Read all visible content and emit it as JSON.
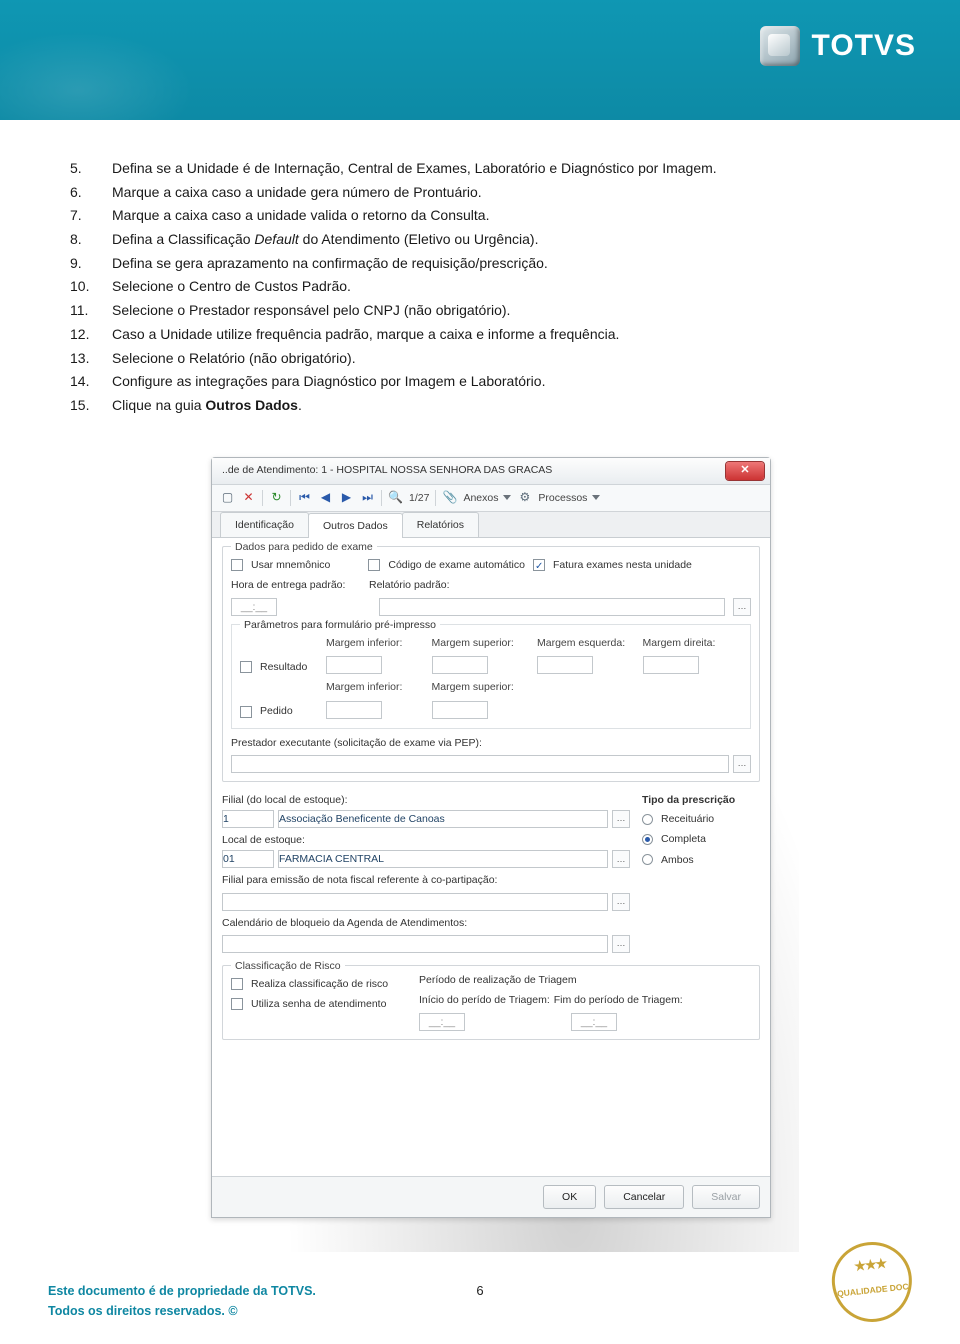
{
  "logo_text": "TOTVS",
  "list": [
    {
      "n": "5.",
      "txt": "Defina se a Unidade é de Internação, Central de Exames, Laboratório e Diagnóstico por Imagem."
    },
    {
      "n": "6.",
      "txt": "Marque a caixa caso a unidade gera número de Prontuário."
    },
    {
      "n": "7.",
      "txt": "Marque a caixa caso a unidade valida o retorno da Consulta."
    },
    {
      "n": "8.",
      "pre": "Defina a Classificação ",
      "em": "Default",
      "post": " do Atendimento (Eletivo ou Urgência)."
    },
    {
      "n": "9.",
      "txt": "Defina se gera aprazamento na confirmação de requisição/prescrição."
    },
    {
      "n": "10.",
      "txt": "Selecione o Centro de Custos Padrão."
    },
    {
      "n": "11.",
      "txt": "Selecione o Prestador responsável pelo CNPJ (não obrigatório)."
    },
    {
      "n": "12.",
      "txt": "Caso a Unidade utilize frequência padrão, marque a caixa e informe a frequência."
    },
    {
      "n": "13.",
      "txt": "Selecione o Relatório (não obrigatório)."
    },
    {
      "n": "14.",
      "txt": "Configure as integrações para Diagnóstico por Imagem e Laboratório."
    },
    {
      "n": "15.",
      "pre": "Clique na guia ",
      "strong": "Outros Dados",
      "post": "."
    }
  ],
  "window": {
    "title": "..de de Atendimento: 1 - HOSPITAL NOSSA SENHORA DAS GRACAS",
    "pager": "1/27",
    "menu_anexos": "Anexos",
    "menu_processos": "Processos",
    "tabs": [
      "Identificação",
      "Outros Dados",
      "Relatórios"
    ],
    "g_exame_title": "Dados para pedido de exame",
    "cb_mnemonico": "Usar mnemônico",
    "cb_codigo_auto": "Código de exame automático",
    "cb_fatura_unidade": "Fatura exames nesta unidade",
    "lbl_hora_entrega": "Hora de entrega padrão:",
    "val_hora_entrega": "__:__",
    "lbl_relatorio_padrao": "Relatório padrão:",
    "sg_param": "Parâmetros para formulário pré-impresso",
    "col_marg_inf": "Margem inferior:",
    "col_marg_sup": "Margem superior:",
    "col_marg_esq": "Margem esquerda:",
    "col_marg_dir": "Margem direita:",
    "cb_resultado": "Resultado",
    "cb_pedido": "Pedido",
    "lbl_prestador_exec": "Prestador executante (solicitação de exame via PEP):",
    "lbl_filial_local": "Filial (do local de estoque):",
    "val_filial_code": "1",
    "val_filial_name": "Associação Beneficente de Canoas",
    "lbl_local_estoque": "Local de estoque:",
    "val_local_code": "01",
    "val_local_name": "FARMACIA CENTRAL",
    "lbl_filial_nf": "Filial para emissão de nota fiscal referente à co-partipação:",
    "lbl_calendario": "Calendário de bloqueio da Agenda de Atendimentos:",
    "side_title": "Tipo da prescrição",
    "radio_receituario": "Receituário",
    "radio_completa": "Completa",
    "radio_ambos": "Ambos",
    "g_risco": "Classificação de Risco",
    "cb_risco": "Realiza classificação de risco",
    "cb_senha": "Utiliza senha de atendimento",
    "lbl_periodo_triagem": "Período de realização de Triagem",
    "lbl_ini_triagem": "Início do perído de Triagem:",
    "lbl_fim_triagem": "Fim do período de Triagem:",
    "val_time": "__:__",
    "btn_ok": "OK",
    "btn_cancel": "Cancelar",
    "btn_save": "Salvar"
  },
  "footer": {
    "line1": "Este documento é de propriedade da TOTVS.",
    "line2": "Todos os direitos reservados. ©",
    "page": "6",
    "badge": "QUALIDADE DOC"
  }
}
